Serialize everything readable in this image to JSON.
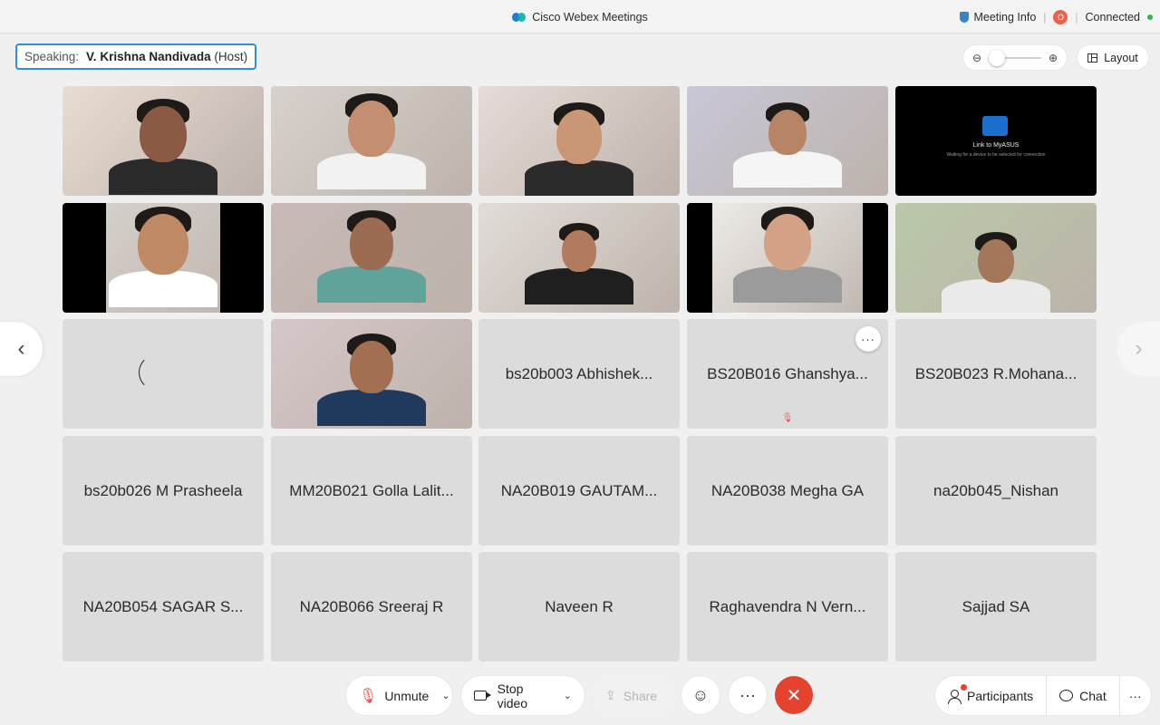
{
  "window": {
    "title": "Cisco Webex Meetings",
    "meeting_info": "Meeting Info",
    "recording_badge": "O",
    "connection_status": "Connected"
  },
  "speaking": {
    "label": "Speaking:",
    "name": "V. Krishna Nandivada",
    "role": "(Host)"
  },
  "controls_top": {
    "layout_label": "Layout",
    "zoom_out_icon": "zoom-out-icon",
    "zoom_in_icon": "zoom-in-icon"
  },
  "video_tiles": [
    {
      "id": "v1",
      "kind": "video",
      "bg": "#e9dcd3"
    },
    {
      "id": "v2",
      "kind": "video",
      "bg": "#d8d2cc"
    },
    {
      "id": "v3",
      "kind": "video",
      "bg": "#e6dcd7"
    },
    {
      "id": "v4",
      "kind": "video",
      "bg": "#c9c7d8"
    },
    {
      "id": "v5",
      "kind": "screen",
      "title": "Link to MyASUS",
      "subtitle": "Waiting for a device to be selected for connection"
    },
    {
      "id": "v6",
      "kind": "video",
      "bg": "#d9d4d0"
    },
    {
      "id": "v7",
      "kind": "video",
      "bg": "#c8b9b6"
    },
    {
      "id": "v8",
      "kind": "video",
      "bg": "#e2ddd7"
    },
    {
      "id": "v9",
      "kind": "video",
      "bg": "#f1efec"
    },
    {
      "id": "v10",
      "kind": "video",
      "bg": "#b9c9a8"
    },
    {
      "id": "v11",
      "kind": "loading"
    },
    {
      "id": "v12",
      "kind": "video",
      "bg": "#d6c7c9"
    }
  ],
  "name_tiles": [
    "bs20b003 Abhishek...",
    "BS20B016 Ghanshya...",
    "BS20B023 R.Mohana...",
    "bs20b026 M Prasheela",
    "MM20B021 Golla Lalit...",
    "NA20B019 GAUTAM...",
    "NA20B038 Megha GA",
    "na20b045_Nishan",
    "NA20B054 SAGAR S...",
    "NA20B066 Sreeraj R",
    "Naveen R",
    "Raghavendra N Vern...",
    "Sajjad SA"
  ],
  "tile_more_label": "···",
  "bottom": {
    "unmute": "Unmute",
    "stop_video": "Stop video",
    "share": "Share",
    "participants": "Participants",
    "chat": "Chat",
    "more": "···",
    "end": "✕"
  },
  "colors": {
    "accent_blue": "#2f8fd8",
    "end_red": "#e5432f",
    "connected_green": "#2db84d",
    "tile_gray": "#dcdcdc"
  }
}
